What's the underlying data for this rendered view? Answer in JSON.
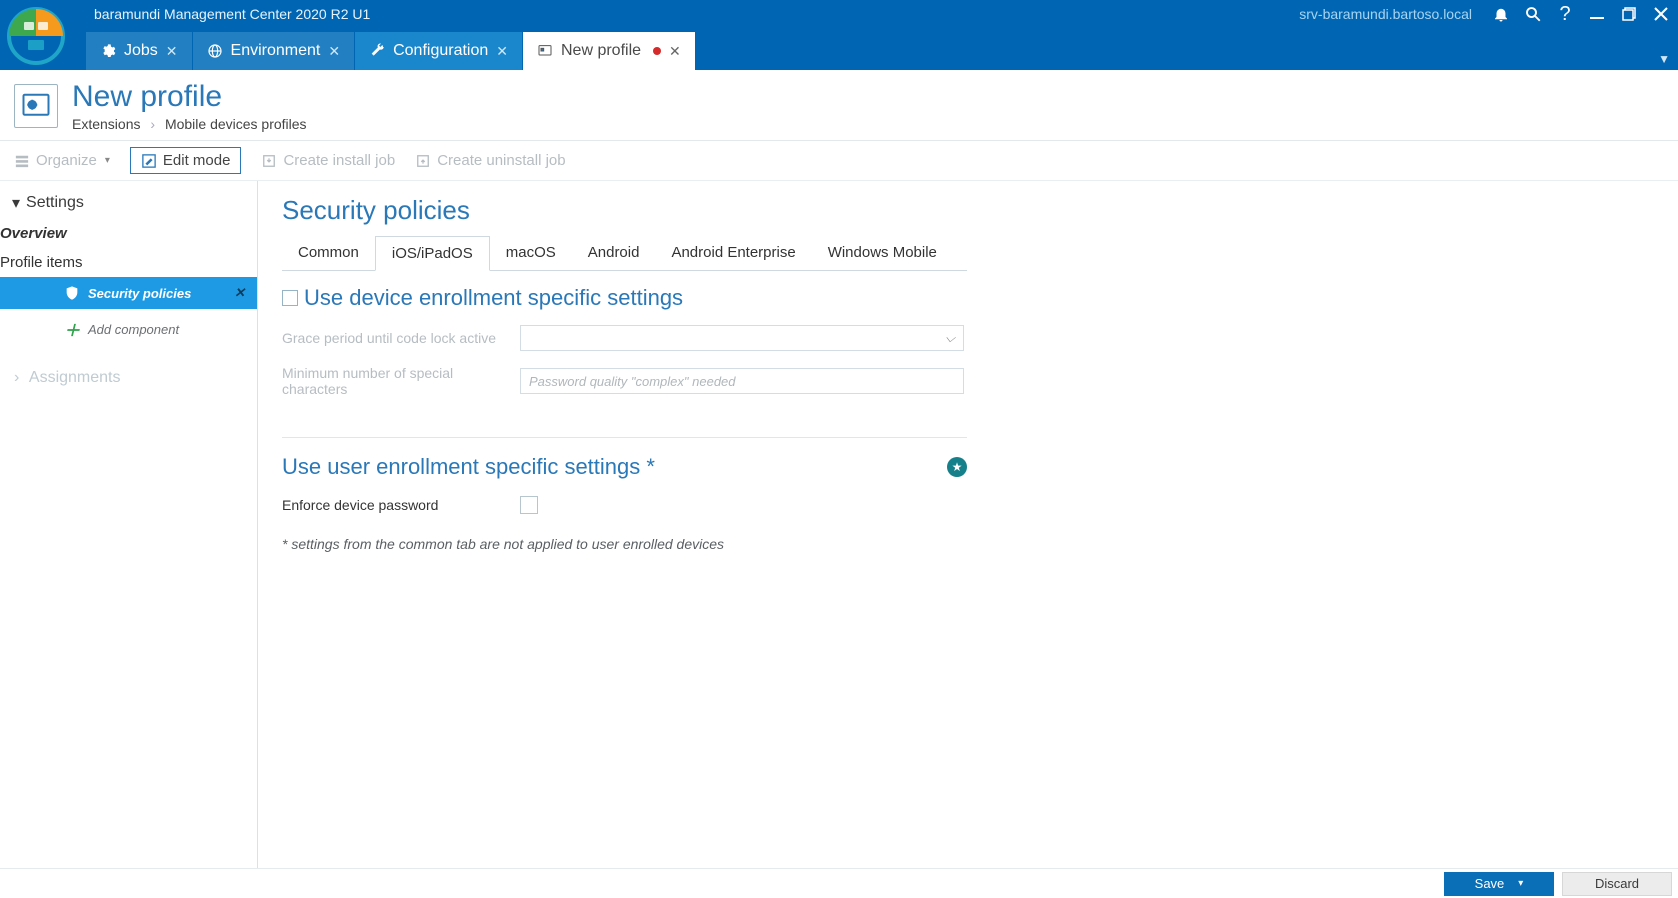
{
  "titlebar": {
    "app": "baramundi Management Center 2020 R2 U1",
    "host": "srv-baramundi.bartoso.local"
  },
  "tabs": [
    {
      "label": "Jobs"
    },
    {
      "label": "Environment"
    },
    {
      "label": "Configuration"
    },
    {
      "label": "New profile"
    }
  ],
  "header": {
    "title": "New profile",
    "breadcrumb1": "Extensions",
    "breadcrumb2": "Mobile devices profiles"
  },
  "toolbar": {
    "organize": "Organize",
    "edit": "Edit mode",
    "create_install": "Create install job",
    "create_uninstall": "Create uninstall job"
  },
  "sidebar": {
    "settings": "Settings",
    "overview": "Overview",
    "profile_items": "Profile items",
    "security": "Security policies",
    "add": "Add component",
    "assignments": "Assignments"
  },
  "content": {
    "title": "Security policies",
    "subtabs": {
      "common": "Common",
      "ios": "iOS/iPadOS",
      "macos": "macOS",
      "android": "Android",
      "ae": "Android Enterprise",
      "wm": "Windows Mobile"
    },
    "section1": "Use device enrollment specific settings",
    "grace_label": "Grace period until code lock active",
    "grace_placeholder": "",
    "min_label": "Minimum number of special characters",
    "min_placeholder": "Password quality \"complex\" needed",
    "section2": "Use user enrollment specific settings *",
    "enforce": "Enforce device password",
    "note": "* settings from the common tab are not applied to user enrolled devices"
  },
  "footer": {
    "save": "Save",
    "discard": "Discard"
  }
}
